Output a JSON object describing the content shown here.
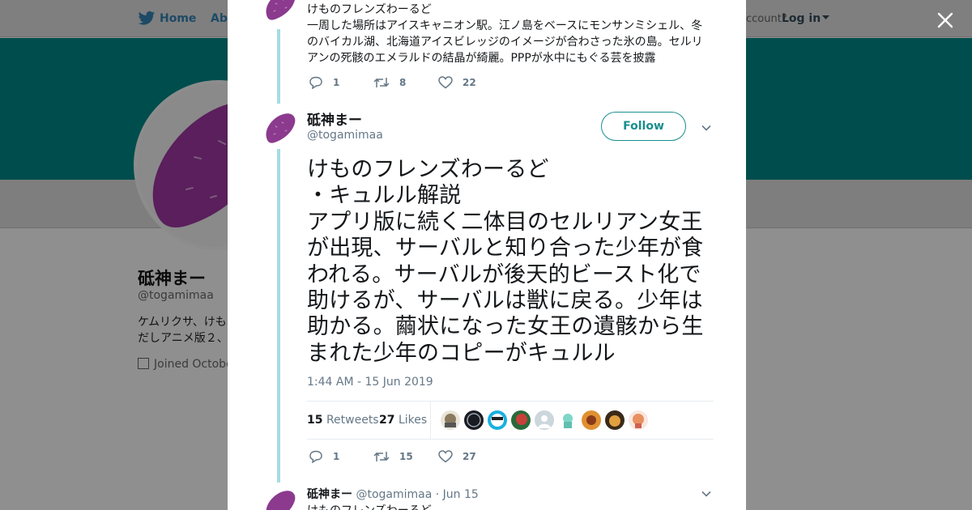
{
  "background": {
    "nav": {
      "home": "Home",
      "about": "Abo",
      "account": "ccount?",
      "login": "Log in"
    },
    "profile": {
      "name": "砥神まー",
      "handle": "@togamimaa",
      "bio_line1": "ケムリクサ、けも",
      "bio_line2": "だしアニメ版２、",
      "joined": "Joined Octobe"
    },
    "colors": {
      "banner": "#004d4d",
      "overlay": "#8f8f8f"
    }
  },
  "close_icon": "close-icon",
  "tweet_prev": {
    "text_line1": "けものフレンズわーるど",
    "text_rest": "一周した場所はアイスキャニオン駅。江ノ島をベースにモンサンミシェル、冬のバイカル湖、北海道アイスビレッジのイメージが合わさった氷の島。セルリアンの死骸のエメラルドの結晶が綺麗。PPPが水中にもぐる芸を披露",
    "replies": "1",
    "retweets": "8",
    "likes": "22"
  },
  "tweet_main": {
    "name": "砥神まー",
    "handle": "@togamimaa",
    "follow_label": "Follow",
    "text": "けものフレンズわーるど\n・キュルル解説\nアプリ版に続く二体目のセルリアン女王が出現、サーバルと知り合った少年が食われる。サーバルが後天的ビースト化で助けるが、サーバルは獣に戻る。少年は助かる。繭状になった女王の遺骸から生まれた少年のコピーがキュルル",
    "timestamp": "1:44 AM - 15 Jun 2019",
    "retweet_count": "15",
    "retweet_label": "Retweets",
    "like_count": "27",
    "like_label": "Likes",
    "replies": "1",
    "retweets": "15",
    "likes": "27"
  },
  "tweet_next": {
    "name": "砥神まー",
    "handle": "@togamimaa",
    "date": "· Jun 15",
    "text": "けものフレンズわーるど"
  },
  "colors": {
    "accent": "#1a8e8e",
    "thread": "#a5dde4",
    "muted": "#657786",
    "avatar": "#8b3a8e"
  }
}
